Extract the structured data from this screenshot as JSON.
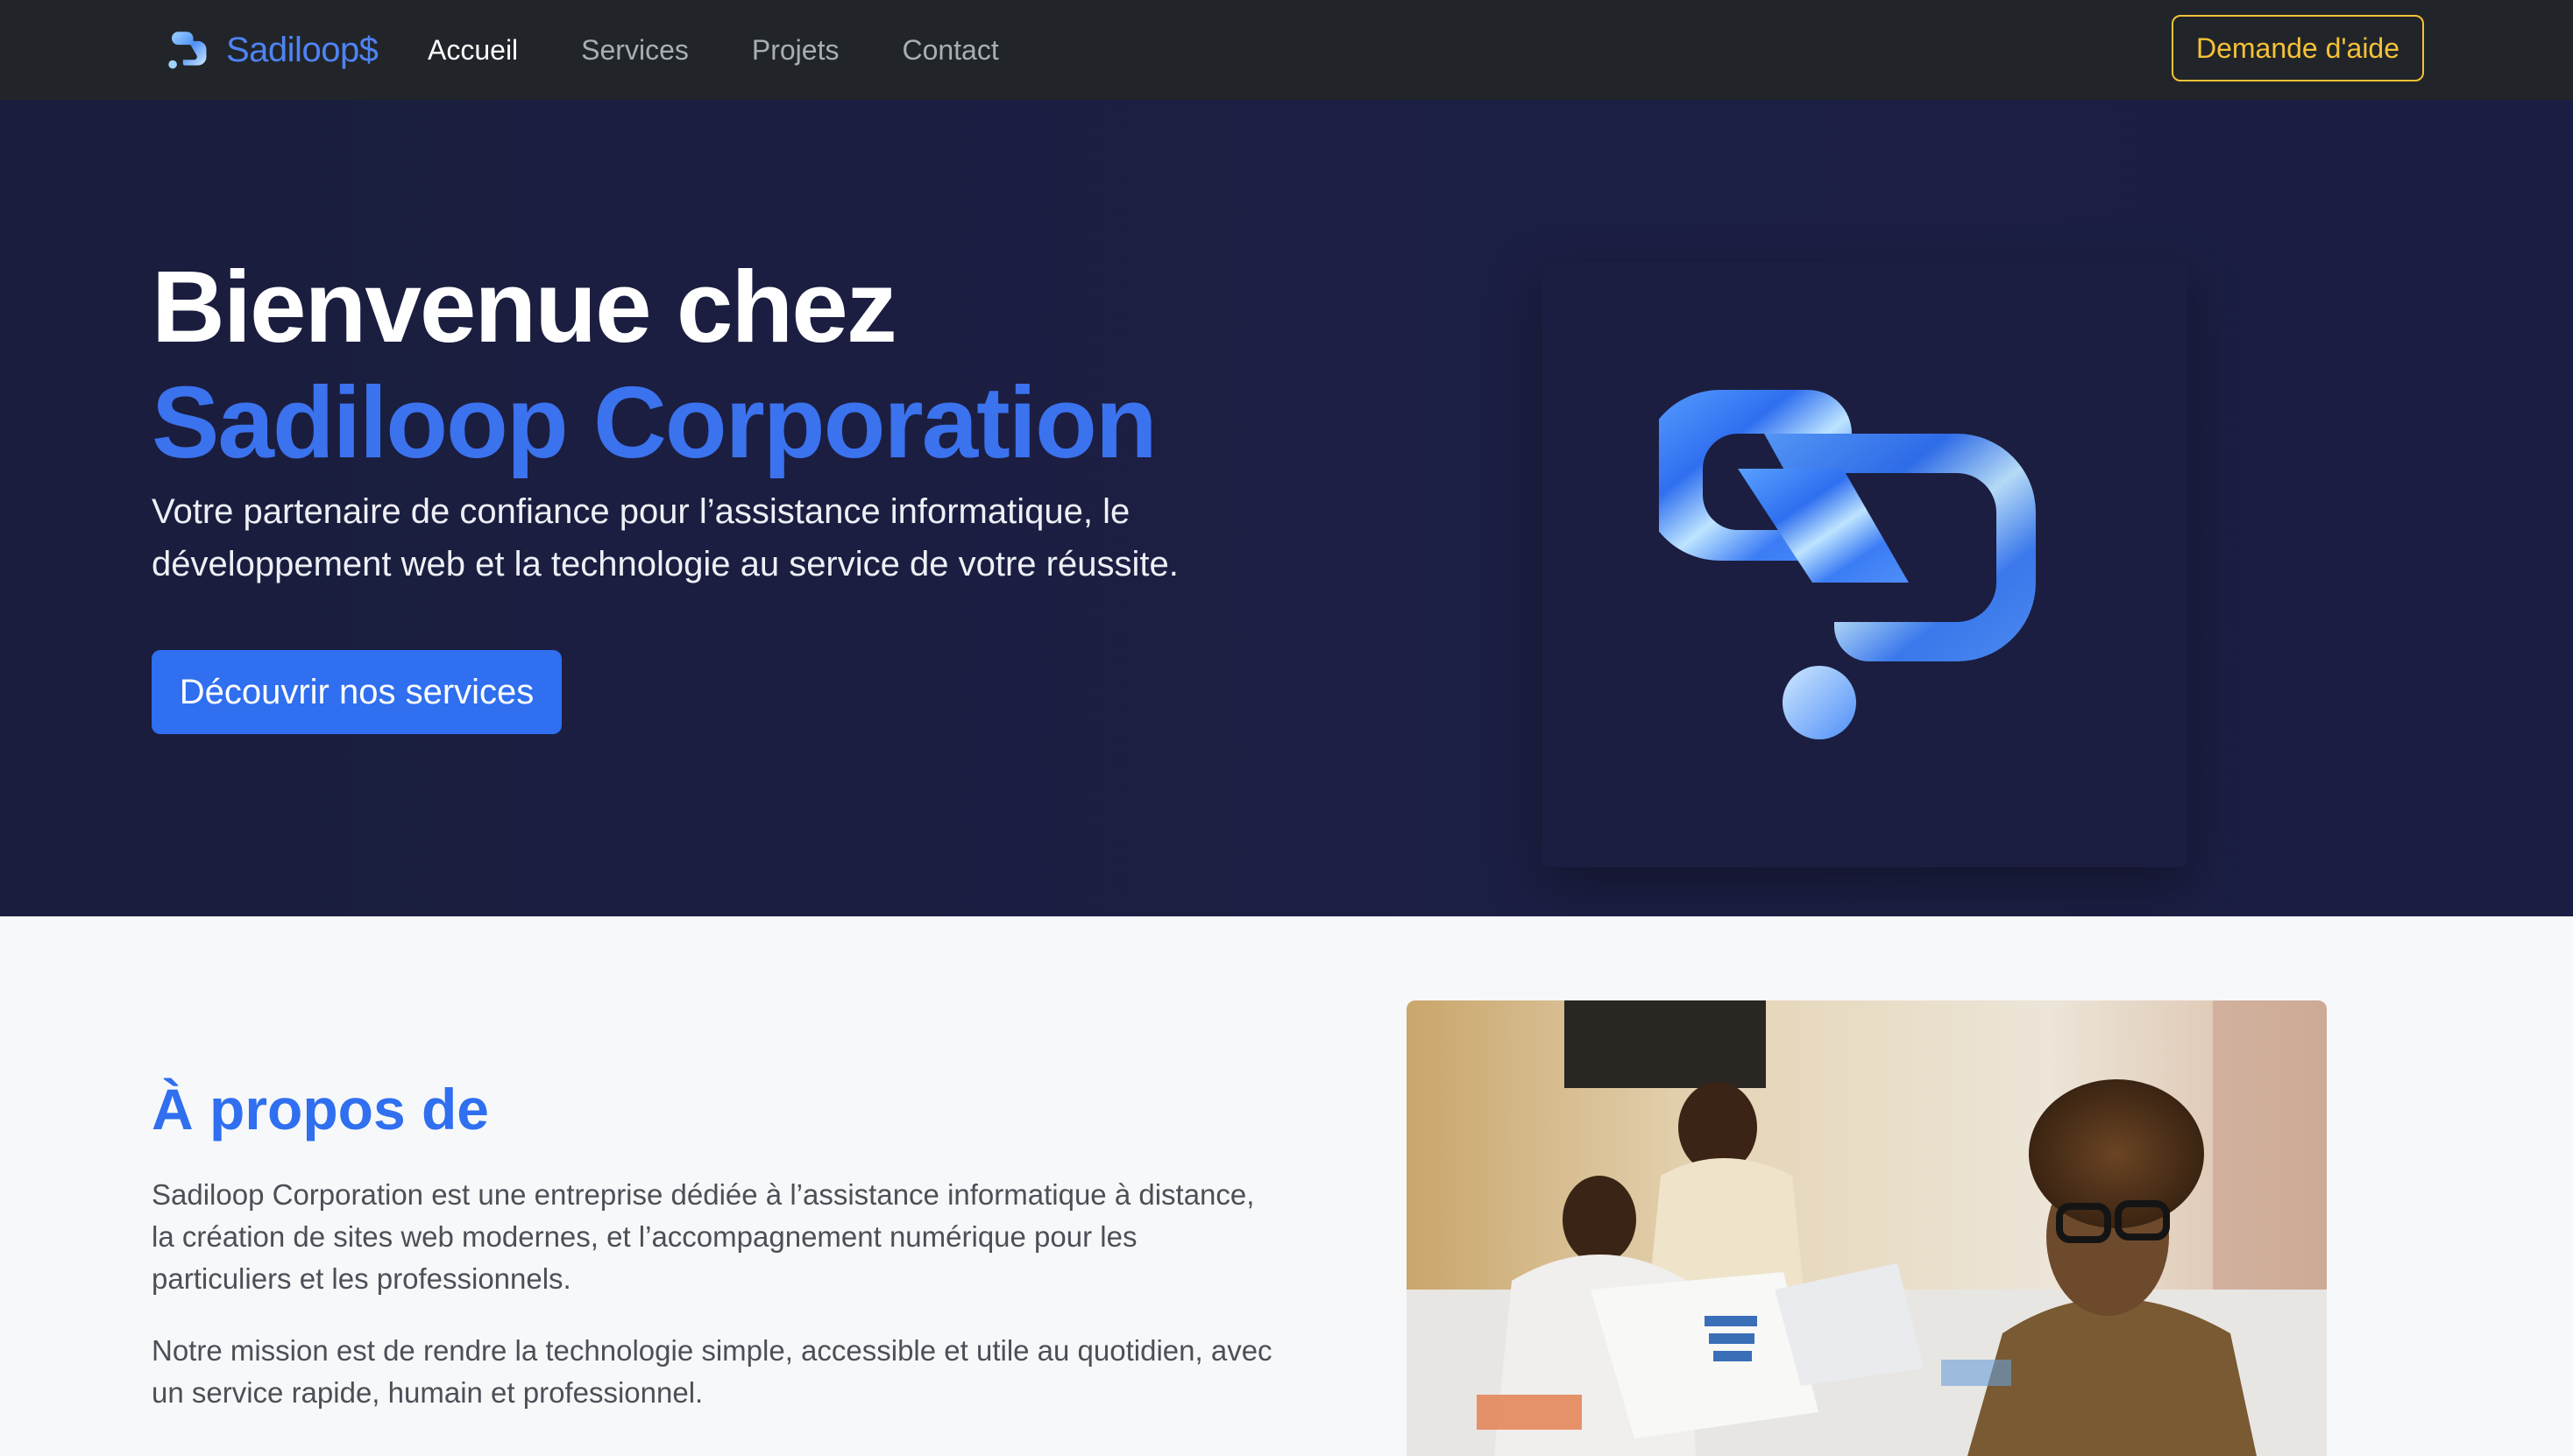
{
  "navbar": {
    "brand": "Sadiloop$",
    "links": [
      {
        "label": "Accueil",
        "active": true
      },
      {
        "label": "Services",
        "active": false
      },
      {
        "label": "Projets",
        "active": false
      },
      {
        "label": "Contact",
        "active": false
      }
    ],
    "help_button": "Demande d'aide"
  },
  "hero": {
    "title_line1": "Bienvenue chez",
    "title_line2": "Sadiloop Corporation",
    "subtitle": "Votre partenaire de confiance pour l’assistance informatique, le développement web et la technologie au service de votre réussite.",
    "cta": "Découvrir nos services"
  },
  "about": {
    "title": "À propos de",
    "paragraph1": "Sadiloop Corporation est une entreprise dédiée à l’assistance informatique à distance, la création de sites web modernes, et l’accompagnement numérique pour les particuliers et les professionnels.",
    "paragraph2": "Notre mission est de rendre la technologie simple, accessible et utile au quotidien, avec un service rapide, humain et professionnel."
  },
  "colors": {
    "navbar_bg": "#212529",
    "brand": "#4f83f3",
    "accent_blue": "#2f6ff0",
    "help_yellow": "#f5c136",
    "hero_bg": "#1c1f44"
  },
  "icons": [
    "sadiloop-logo-icon",
    "sadiloop-hero-logo"
  ]
}
